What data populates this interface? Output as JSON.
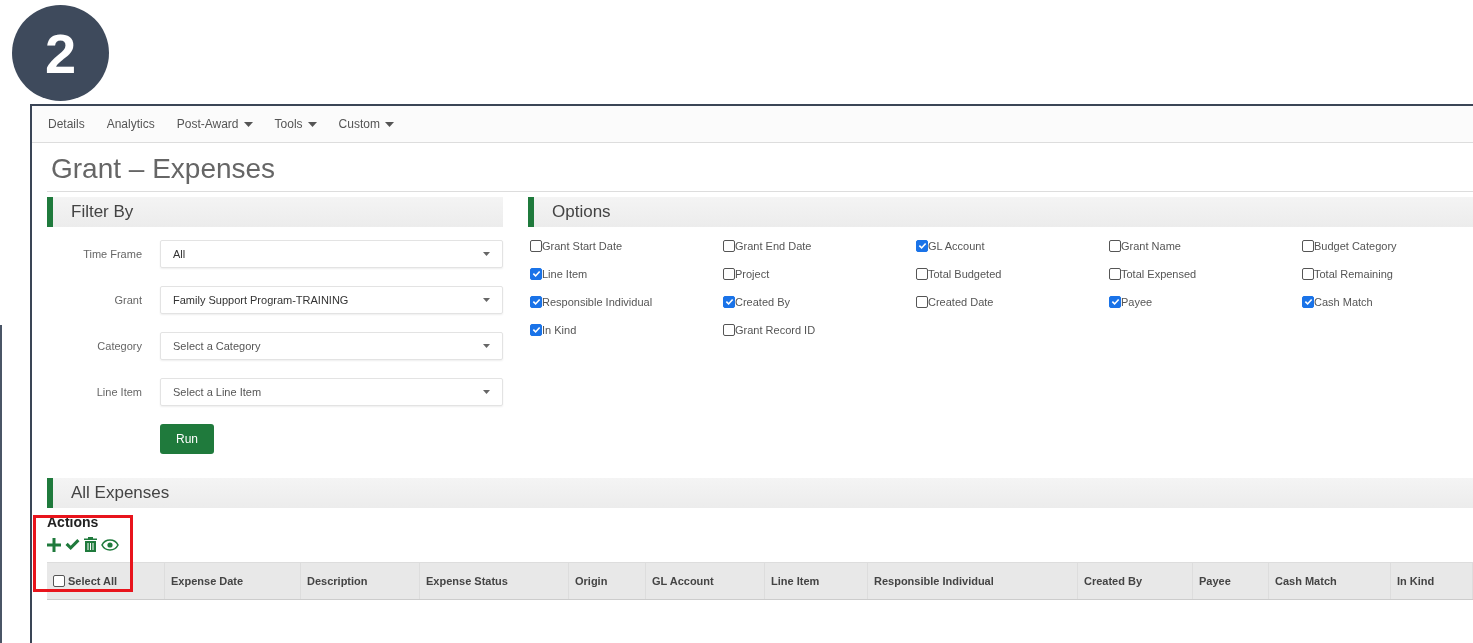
{
  "badge": "2",
  "nav": [
    {
      "label": "Details",
      "dropdown": false
    },
    {
      "label": "Analytics",
      "dropdown": false
    },
    {
      "label": "Post-Award",
      "dropdown": true
    },
    {
      "label": "Tools",
      "dropdown": true
    },
    {
      "label": "Custom",
      "dropdown": true
    }
  ],
  "title": "Grant – Expenses",
  "filter": {
    "title": "Filter By",
    "fields": [
      {
        "label": "Time Frame",
        "value": "All"
      },
      {
        "label": "Grant",
        "value": "Family Support Program-TRAINING"
      },
      {
        "label": "Category",
        "placeholder": "Select a Category"
      },
      {
        "label": "Line Item",
        "placeholder": "Select a Line Item"
      }
    ],
    "run_button": "Run"
  },
  "options": {
    "title": "Options",
    "items": [
      {
        "label": "Grant Start Date",
        "checked": false
      },
      {
        "label": "Grant End Date",
        "checked": false
      },
      {
        "label": "GL Account",
        "checked": true
      },
      {
        "label": "Grant Name",
        "checked": false
      },
      {
        "label": "Budget Category",
        "checked": false
      },
      {
        "label": "Line Item",
        "checked": true
      },
      {
        "label": "Project",
        "checked": false
      },
      {
        "label": "Total Budgeted",
        "checked": false
      },
      {
        "label": "Total Expensed",
        "checked": false
      },
      {
        "label": "Total Remaining",
        "checked": false
      },
      {
        "label": "Responsible Individual",
        "checked": true
      },
      {
        "label": "Created By",
        "checked": true
      },
      {
        "label": "Created Date",
        "checked": false
      },
      {
        "label": "Payee",
        "checked": true
      },
      {
        "label": "Cash Match",
        "checked": true
      },
      {
        "label": "In Kind",
        "checked": true
      },
      {
        "label": "Grant Record ID",
        "checked": false
      }
    ]
  },
  "expenses": {
    "title": "All Expenses",
    "actions_label": "Actions",
    "columns": [
      {
        "label": "Select All",
        "kind": "checkbox",
        "checked": false
      },
      {
        "label": "Expense Date",
        "kind": "text"
      },
      {
        "label": "Description",
        "kind": "text"
      },
      {
        "label": "Expense Status",
        "kind": "text"
      },
      {
        "label": "Origin",
        "kind": "text"
      },
      {
        "label": "GL Account",
        "kind": "text"
      },
      {
        "label": "Line Item",
        "kind": "text"
      },
      {
        "label": "Responsible Individual",
        "kind": "text"
      },
      {
        "label": "Created By",
        "kind": "text"
      },
      {
        "label": "Payee",
        "kind": "text"
      },
      {
        "label": "Cash Match",
        "kind": "text"
      },
      {
        "label": "In Kind",
        "kind": "text"
      }
    ]
  }
}
